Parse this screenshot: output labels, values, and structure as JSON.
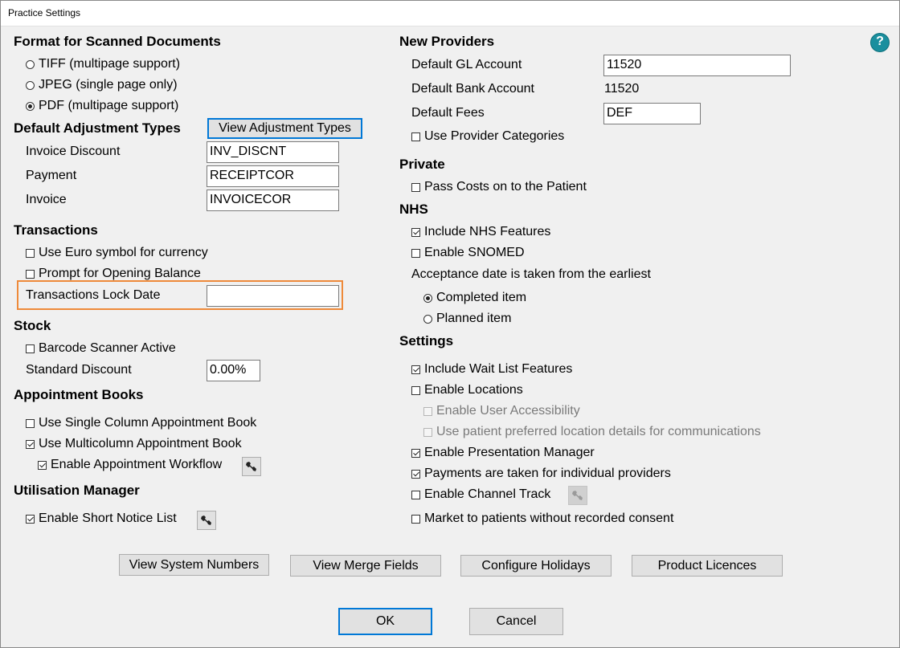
{
  "window": {
    "title": "Practice Settings"
  },
  "help": {
    "label": "?",
    "icon": "help-icon"
  },
  "scanned": {
    "header": "Format for Scanned Documents",
    "options": [
      "TIFF (multipage support)",
      "JPEG (single page only)",
      "PDF (multipage support)"
    ],
    "selected": "PDF (multipage support)"
  },
  "adjustment": {
    "header": "Default Adjustment Types",
    "view_button": "View Adjustment Types",
    "invoice_discount_label": "Invoice Discount",
    "invoice_discount_value": "INV_DISCNT",
    "payment_label": "Payment",
    "payment_value": "RECEIPTCOR",
    "invoice_label": "Invoice",
    "invoice_value": "INVOICECOR"
  },
  "transactions": {
    "header": "Transactions",
    "euro_label": "Use Euro symbol for currency",
    "euro_checked": false,
    "opening_label": "Prompt for Opening Balance",
    "opening_checked": false,
    "lock_date_label": "Transactions Lock Date",
    "lock_date_value": ""
  },
  "stock": {
    "header": "Stock",
    "barcode_label": "Barcode Scanner Active",
    "barcode_checked": false,
    "discount_label": "Standard Discount",
    "discount_value": "0.00%"
  },
  "appointment": {
    "header": "Appointment Books",
    "single_label": "Use Single Column Appointment Book",
    "single_checked": false,
    "multi_label": "Use Multicolumn Appointment Book",
    "multi_checked": true,
    "workflow_label": "Enable Appointment Workflow",
    "workflow_checked": true
  },
  "utilisation": {
    "header": "Utilisation Manager",
    "short_notice_label": "Enable Short Notice List",
    "short_notice_checked": true
  },
  "providers": {
    "header": "New Providers",
    "gl_label": "Default GL Account",
    "gl_value": "11520",
    "bank_label": "Default Bank Account",
    "bank_value": "11520",
    "fees_label": "Default Fees",
    "fees_value": "DEF",
    "categories_label": "Use Provider Categories",
    "categories_checked": false
  },
  "private": {
    "header": "Private",
    "pass_costs_label": "Pass Costs on to the Patient",
    "pass_costs_checked": false
  },
  "nhs": {
    "header": "NHS",
    "features_label": "Include NHS Features",
    "features_checked": true,
    "snomed_label": "Enable SNOMED",
    "snomed_checked": false,
    "acceptance_label": "Acceptance date is taken from the earliest",
    "completed_label": "Completed item",
    "planned_label": "Planned item",
    "acceptance_selected": "Completed item"
  },
  "settings": {
    "header": "Settings",
    "wait_list_label": "Include Wait List Features",
    "wait_list_checked": true,
    "locations_label": "Enable Locations",
    "locations_checked": false,
    "accessibility_label": "Enable User Accessibility",
    "preferred_location_label": "Use patient preferred location details for communications",
    "presentation_label": "Enable Presentation Manager",
    "presentation_checked": true,
    "payments_label": "Payments are taken for individual providers",
    "payments_checked": true,
    "channel_label": "Enable Channel Track",
    "channel_checked": false,
    "market_label": "Market to patients without recorded consent",
    "market_checked": false
  },
  "footer": {
    "system_numbers": "View System Numbers",
    "merge_fields": "View Merge Fields",
    "holidays": "Configure Holidays",
    "licences": "Product Licences",
    "ok": "OK",
    "cancel": "Cancel"
  },
  "colors": {
    "accent": "#0078d7",
    "highlight": "#ee8a3a",
    "help": "#1b8f9e"
  }
}
